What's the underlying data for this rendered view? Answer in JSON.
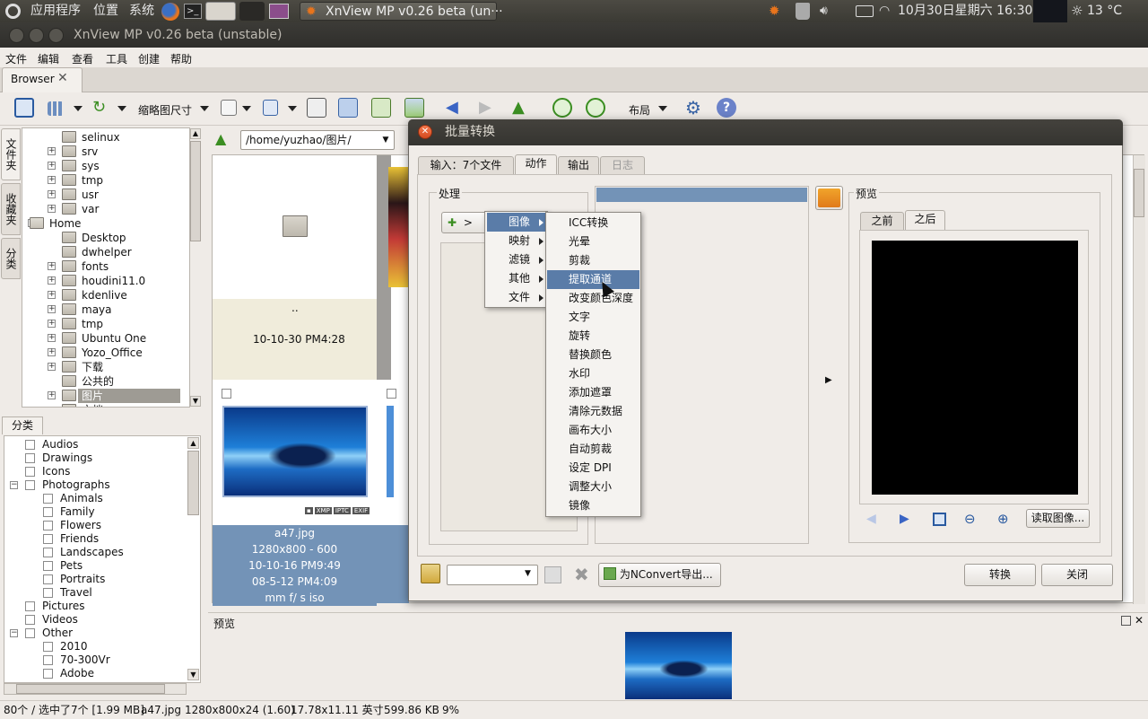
{
  "top_panel": {
    "apps_menu": "应用程序",
    "places_menu": "位置",
    "system_menu": "系统",
    "active_task": "XnView MP v0.26 beta (un···",
    "datetime": "10月30日星期六 16:30",
    "temperature": "13 °C"
  },
  "window": {
    "title": "XnView MP v0.26 beta (unstable)"
  },
  "menubar": [
    "文件",
    "编辑",
    "查看",
    "工具",
    "创建",
    "帮助"
  ],
  "browser_tab": "Browser",
  "toolbar": {
    "thumb_size": "缩略图尺寸",
    "layout": "布局"
  },
  "side_tabs": [
    "文件夹",
    "收藏夹",
    "分类"
  ],
  "folder_tree": [
    {
      "label": "selinux",
      "indent": 1,
      "expand": false
    },
    {
      "label": "srv",
      "indent": 1,
      "expand": true
    },
    {
      "label": "sys",
      "indent": 1,
      "expand": true
    },
    {
      "label": "tmp",
      "indent": 1,
      "expand": true
    },
    {
      "label": "usr",
      "indent": 1,
      "expand": true
    },
    {
      "label": "var",
      "indent": 1,
      "expand": true
    },
    {
      "label": "Home",
      "indent": 0,
      "expand": true,
      "home": true
    },
    {
      "label": "Desktop",
      "indent": 1,
      "expand": false
    },
    {
      "label": "dwhelper",
      "indent": 1,
      "expand": false
    },
    {
      "label": "fonts",
      "indent": 1,
      "expand": true
    },
    {
      "label": "houdini11.0",
      "indent": 1,
      "expand": true
    },
    {
      "label": "kdenlive",
      "indent": 1,
      "expand": true
    },
    {
      "label": "maya",
      "indent": 1,
      "expand": true
    },
    {
      "label": "tmp",
      "indent": 1,
      "expand": true
    },
    {
      "label": "Ubuntu One",
      "indent": 1,
      "expand": true
    },
    {
      "label": "Yozo_Office",
      "indent": 1,
      "expand": true
    },
    {
      "label": "下载",
      "indent": 1,
      "expand": true
    },
    {
      "label": "公共的",
      "indent": 1,
      "expand": false
    },
    {
      "label": "图片",
      "indent": 1,
      "expand": true,
      "selected": true
    },
    {
      "label": "文档",
      "indent": 1,
      "expand": false
    }
  ],
  "categories_tab": "分类",
  "categories": [
    {
      "label": "Audios",
      "level": 0
    },
    {
      "label": "Drawings",
      "level": 0
    },
    {
      "label": "Icons",
      "level": 0
    },
    {
      "label": "Photographs",
      "level": 0,
      "expand": true
    },
    {
      "label": "Animals",
      "level": 1
    },
    {
      "label": "Family",
      "level": 1
    },
    {
      "label": "Flowers",
      "level": 1
    },
    {
      "label": "Friends",
      "level": 1
    },
    {
      "label": "Landscapes",
      "level": 1
    },
    {
      "label": "Pets",
      "level": 1
    },
    {
      "label": "Portraits",
      "level": 1
    },
    {
      "label": "Travel",
      "level": 1
    },
    {
      "label": "Pictures",
      "level": 0
    },
    {
      "label": "Videos",
      "level": 0
    },
    {
      "label": "Other",
      "level": 0,
      "expand": true
    },
    {
      "label": "2010",
      "level": 1
    },
    {
      "label": "70-300Vr",
      "level": 1
    },
    {
      "label": "Adobe",
      "level": 1
    }
  ],
  "browser": {
    "path": "/home/yuzhao/图片/",
    "parent_label": "..",
    "parent_date": "10-10-30 PM4:28",
    "file_badges": [
      "XMP",
      "IPTC",
      "EXIF"
    ],
    "file_info": [
      "a47.jpg",
      "1280x800 - 600",
      "10-10-16 PM9:49",
      "08-5-12 PM4:09",
      "mm f/ s iso"
    ]
  },
  "preview_pane_title": "预览",
  "status_bar": {
    "count": "80个 / 选中了7个 [1.99 MB]",
    "file": "a47.jpg",
    "dims": "1280x800x24 (1.60)",
    "print_size": "17.78x11.11 英寸",
    "filesize": "599.86 KB",
    "zoom": "9%"
  },
  "dialog": {
    "title": "批量转换",
    "tabs": [
      "输入：7个文件",
      "动作",
      "输出",
      "日志"
    ],
    "active_tab": "动作",
    "process_label": "处理",
    "add_button": ">",
    "preview_label": "预览",
    "preview_tabs": [
      "之前",
      "之后"
    ],
    "read_image_button": "读取图像...",
    "export_button": "为NConvert导出...",
    "convert_button": "转换",
    "close_button": "关闭"
  },
  "menu_level1": [
    "图像",
    "映射",
    "滤镜",
    "其他",
    "文件"
  ],
  "menu_level2": [
    "ICC转换",
    "光晕",
    "剪裁",
    "提取通道",
    "改变颜色深度",
    "文字",
    "旋转",
    "替换颜色",
    "水印",
    "添加遮罩",
    "清除元数据",
    "画布大小",
    "自动剪裁",
    "设定 DPI",
    "调整大小",
    "镜像"
  ],
  "menu_level2_highlighted": "提取通道",
  "colors": {
    "selection": "#7393b7",
    "menu_highlight": "#5a7ca8",
    "title_bar": "#3c3b37",
    "close_orange": "#e9602f"
  }
}
